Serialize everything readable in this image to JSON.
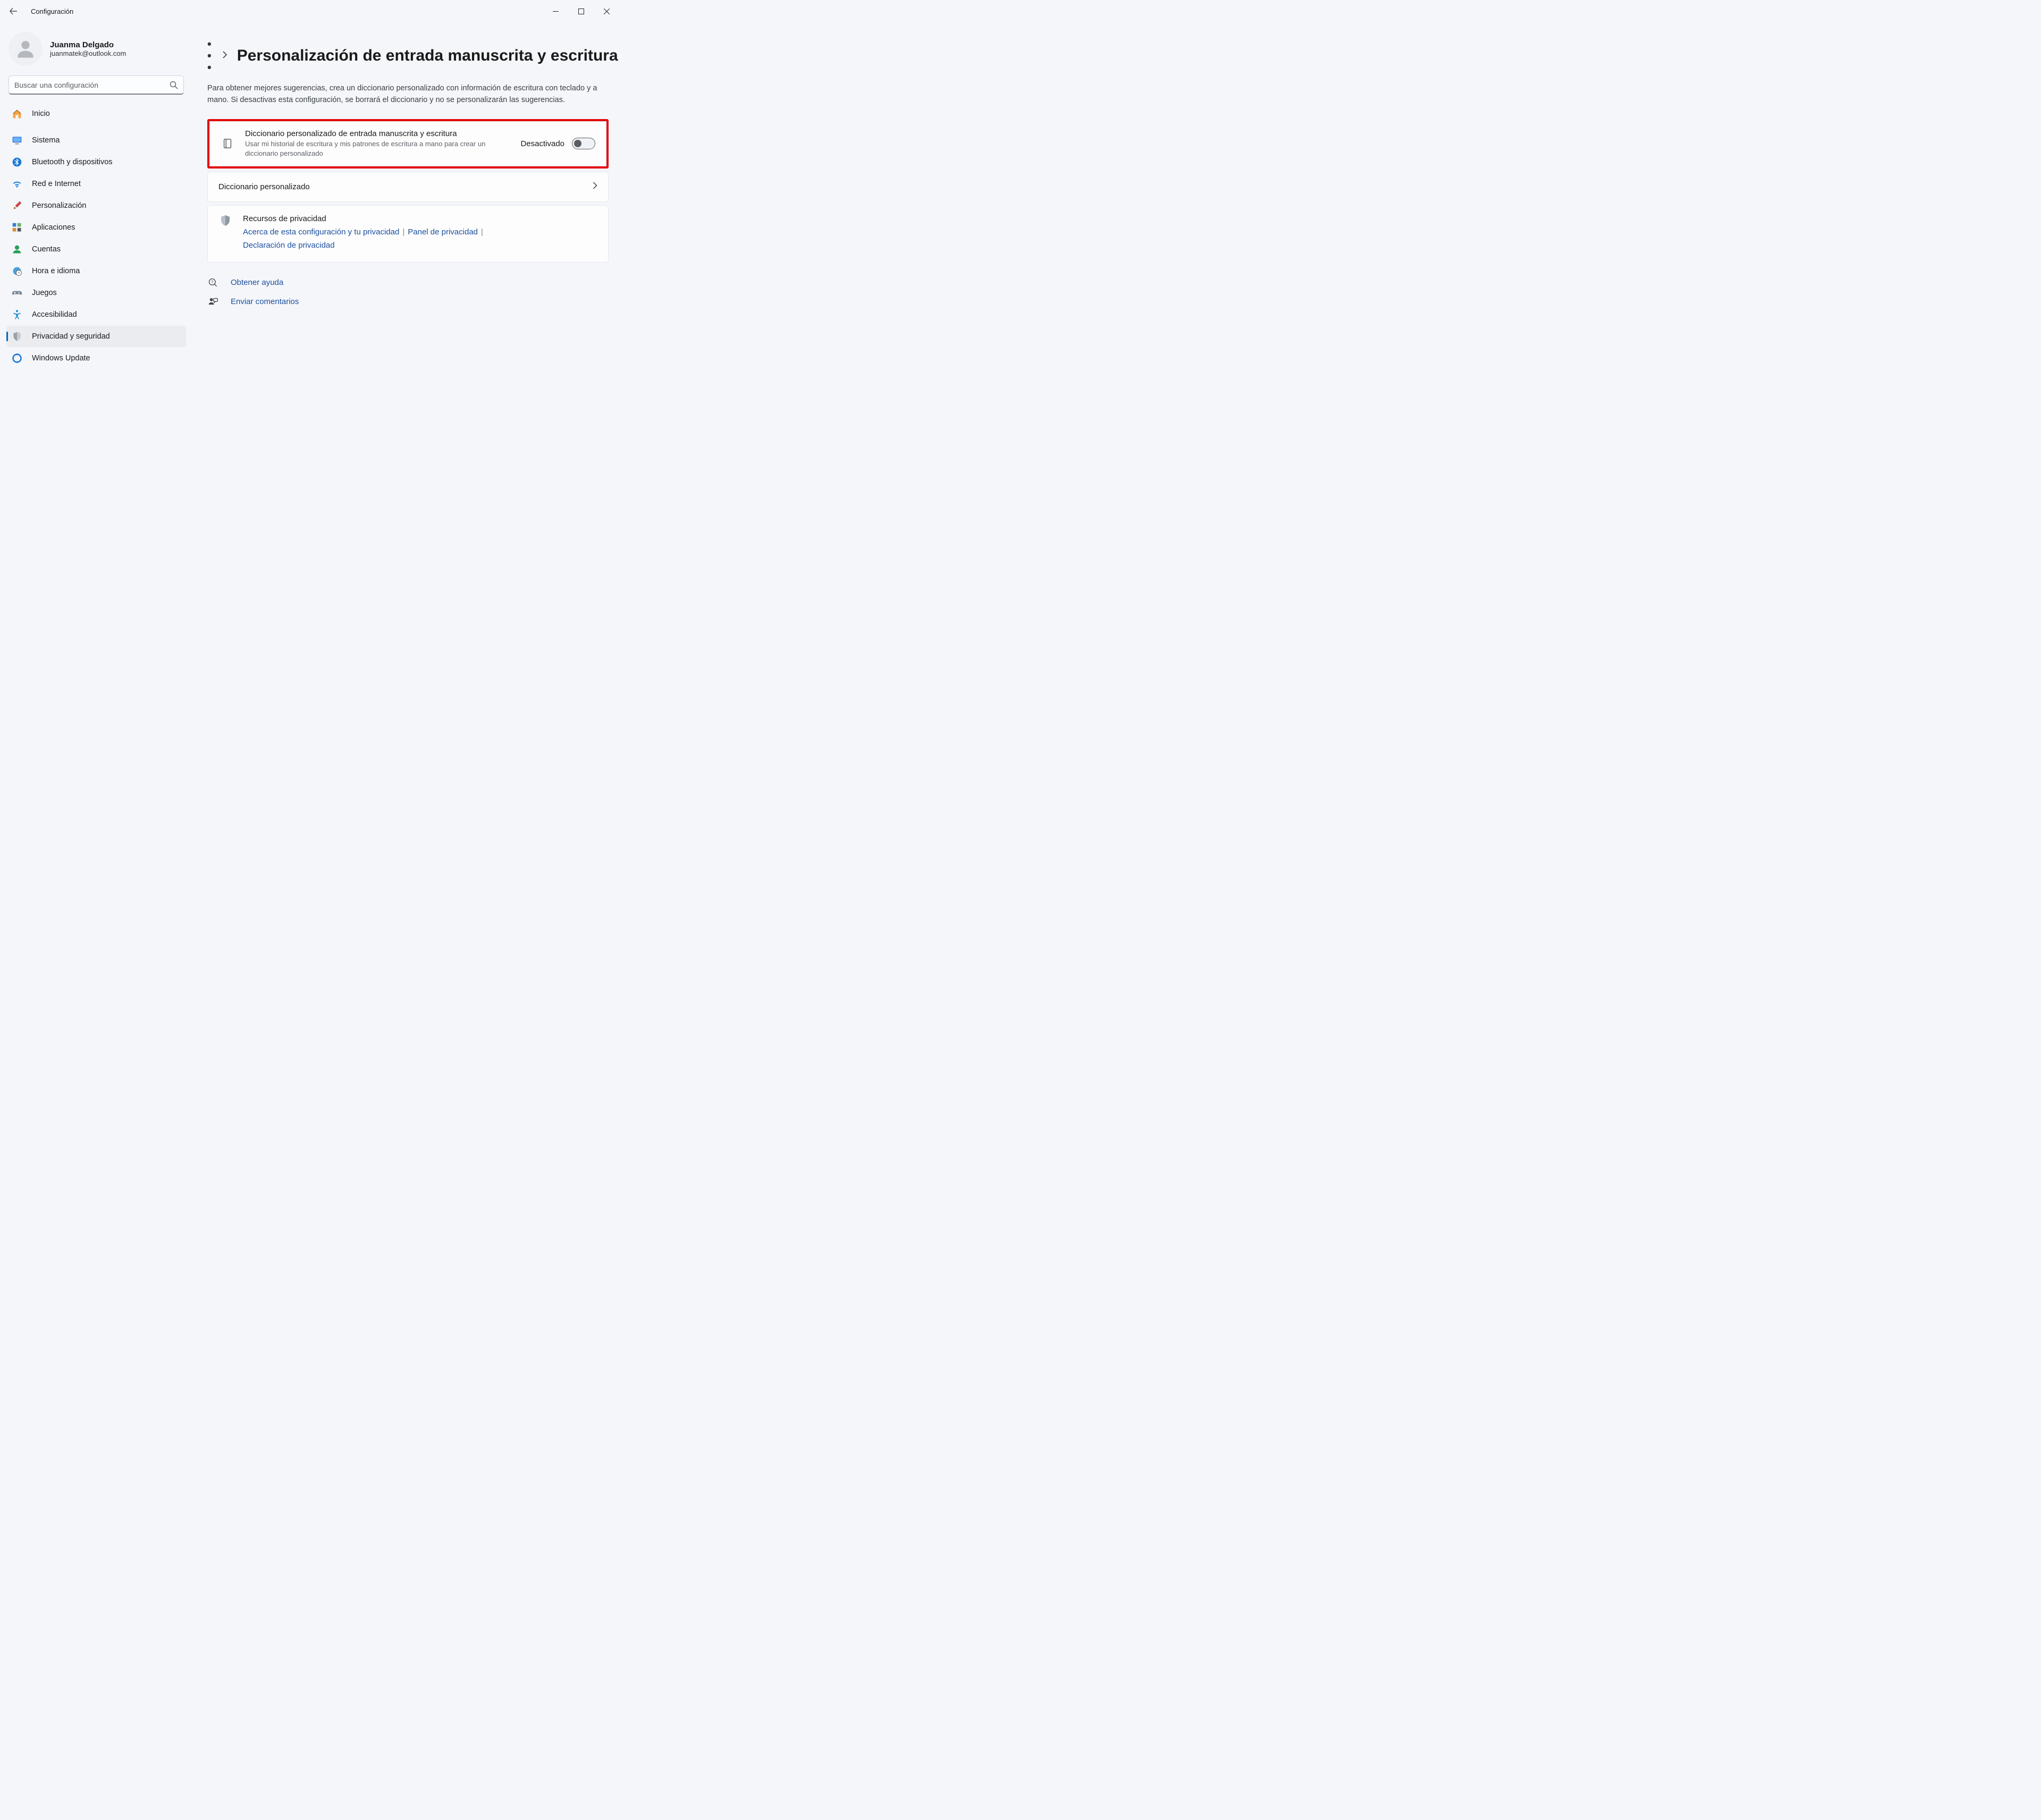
{
  "app": {
    "title": "Configuración"
  },
  "profile": {
    "name": "Juanma Delgado",
    "email": "juanmatek@outlook.com"
  },
  "search": {
    "placeholder": "Buscar una configuración"
  },
  "nav": {
    "home": "Inicio",
    "system": "Sistema",
    "bluetooth": "Bluetooth y dispositivos",
    "network": "Red e Internet",
    "personalization": "Personalización",
    "apps": "Aplicaciones",
    "accounts": "Cuentas",
    "time": "Hora e idioma",
    "gaming": "Juegos",
    "accessibility": "Accesibilidad",
    "privacy": "Privacidad y seguridad",
    "update": "Windows Update"
  },
  "breadcrumb": {
    "more": "• • •",
    "sep": "›",
    "title": "Personalización de entrada manuscrita y escritura"
  },
  "description": "Para obtener mejores sugerencias, crea un diccionario personalizado con información de escritura con teclado y a mano. Si desactivas esta configuración, se borrará el diccionario y no se personalizarán las sugerencias.",
  "toggleCard": {
    "title": "Diccionario personalizado de entrada manuscrita y escritura",
    "sub": "Usar mi historial de escritura y mis patrones de escritura a mano para crear un diccionario personalizado",
    "state": "Desactivado"
  },
  "dictLink": {
    "label": "Diccionario personalizado"
  },
  "privacy": {
    "title": "Recursos de privacidad",
    "link1": "Acerca de esta configuración y tu privacidad",
    "link2": "Panel de privacidad",
    "link3": "Declaración de privacidad"
  },
  "help": {
    "get": "Obtener ayuda",
    "feedback": "Enviar comentarios"
  }
}
